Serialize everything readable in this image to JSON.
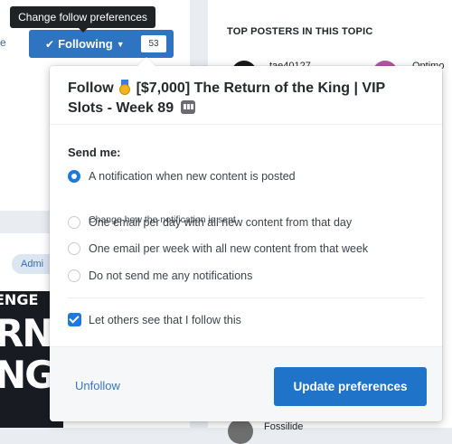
{
  "tooltip": {
    "text": "Change follow preferences"
  },
  "follow_button": {
    "label": "Following",
    "count": "53"
  },
  "edge_link": {
    "text": "e"
  },
  "sidebar": {
    "heading": "TOP POSTERS IN THIS TOPIC",
    "posters": [
      {
        "name": "tae40127"
      },
      {
        "name": "Optimo"
      }
    ],
    "bottom_poster": "Fossilide"
  },
  "admin_badge": {
    "label": "Admi"
  },
  "banner": {
    "line1": "ENGE",
    "line2": "RN",
    "line3": "NG"
  },
  "popup": {
    "title_prefix": "Follow",
    "title_text": "[$7,000] The Return of the King | VIP Slots - Week 89",
    "send_me": "Send me:",
    "options": [
      {
        "label": "A notification when new content is posted",
        "checked": true
      },
      {
        "label": "One email per day with all new content from that day",
        "checked": false
      },
      {
        "label": "One email per week with all new content from that week",
        "checked": false
      },
      {
        "label": "Do not send me any notifications",
        "checked": false
      }
    ],
    "notification_sub_link": "Change how the notification is sent",
    "anonymous_label": "Let others see that I follow this",
    "unfollow_label": "Unfollow",
    "update_label": "Update preferences"
  },
  "colors": {
    "primary": "#1f73c9",
    "accent_blue": "#1d78e0",
    "tooltip_bg": "#202326"
  }
}
